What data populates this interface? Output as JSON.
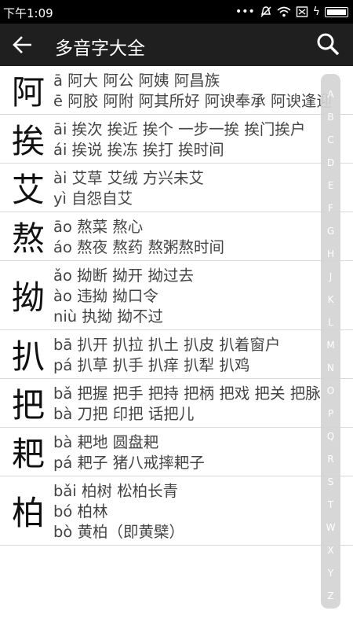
{
  "status_bar": {
    "time": "下午1:09"
  },
  "app_bar": {
    "title": "多音字大全"
  },
  "entries": [
    {
      "char": "阿",
      "lines": [
        "ā 阿大 阿公 阿姨 阿昌族",
        "ē 阿胶 阿附 阿其所好 阿谀奉承 阿谀逢迎"
      ]
    },
    {
      "char": "挨",
      "lines": [
        "āi 挨次 挨近 挨个 一步一挨 挨门挨户",
        "ái 挨说 挨冻 挨打 挨时间"
      ]
    },
    {
      "char": "艾",
      "lines": [
        "ài 艾草 艾绒 方兴未艾",
        "yì 自怨自艾"
      ]
    },
    {
      "char": "熬",
      "lines": [
        "āo 熬菜 熬心",
        "áo 熬夜 熬药 熬粥熬时间"
      ]
    },
    {
      "char": "拗",
      "lines": [
        "ǎo 拗断 拗开 拗过去",
        "ào 违拗 拗口令",
        "niù 执拗 拗不过"
      ]
    },
    {
      "char": "扒",
      "lines": [
        "bā 扒开 扒拉 扒土 扒皮 扒着窗户",
        "pá 扒草 扒手 扒痒 扒犁 扒鸡"
      ]
    },
    {
      "char": "把",
      "lines": [
        "bǎ 把握 把手 把持 把柄 把戏 把关 把脉",
        "bà 刀把 印把 话把儿"
      ]
    },
    {
      "char": "耙",
      "lines": [
        "bà 耙地 圆盘耙",
        "pá 耙子 猪八戒摔耙子"
      ]
    },
    {
      "char": "柏",
      "lines": [
        "bǎi 柏树 松柏长青",
        "bó 柏林",
        "bò 黄柏（即黄檗）"
      ]
    }
  ],
  "index": [
    "A",
    "B",
    "C",
    "D",
    "E",
    "F",
    "G",
    "H",
    "J",
    "K",
    "L",
    "M",
    "N",
    "O",
    "P",
    "Q",
    "R",
    "S",
    "T",
    "W",
    "X",
    "Y",
    "Z"
  ]
}
